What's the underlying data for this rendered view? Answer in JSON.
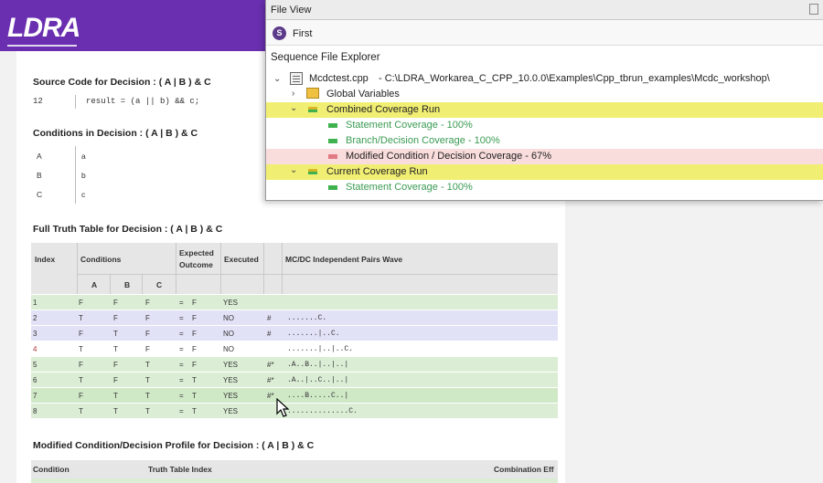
{
  "report": {
    "logo": "LDRA",
    "source_heading": "Source Code for Decision : ( A | B ) & C",
    "source_line_no": "12",
    "source_code": "result = (a || b) && c;",
    "conditions_heading": "Conditions in Decision : ( A | B ) & C",
    "conditions": [
      {
        "key": "A",
        "value": "a"
      },
      {
        "key": "B",
        "value": "b"
      },
      {
        "key": "C",
        "value": "c"
      }
    ],
    "truth_heading": "Full Truth Table for Decision : ( A | B ) & C",
    "truth_table": {
      "headers": {
        "index": "Index",
        "conditions": "Conditions",
        "expected_1": "Expected",
        "expected_2": "Outcome",
        "executed": "Executed",
        "wave": "MC/DC Independent Pairs Wave",
        "a": "A",
        "b": "B",
        "c": "C"
      },
      "rows": [
        {
          "index": "1",
          "a": "F",
          "b": "F",
          "c": "F",
          "eq": "=",
          "out": "F",
          "exec": "YES",
          "mark": "",
          "wave": "",
          "color": "#dbeed5"
        },
        {
          "index": "2",
          "a": "T",
          "b": "F",
          "c": "F",
          "eq": "=",
          "out": "F",
          "exec": "NO",
          "mark": "#",
          "wave": ".......C.",
          "color": "#e2e2f7"
        },
        {
          "index": "3",
          "a": "F",
          "b": "T",
          "c": "F",
          "eq": "=",
          "out": "F",
          "exec": "NO",
          "mark": "#",
          "wave": ".......|..C.",
          "color": "#e2e2f7"
        },
        {
          "index": "4",
          "a": "T",
          "b": "T",
          "c": "F",
          "eq": "=",
          "out": "F",
          "exec": "NO",
          "mark": "",
          "wave": ".......|..|..C.",
          "color": "#ffffff"
        },
        {
          "index": "5",
          "a": "F",
          "b": "F",
          "c": "T",
          "eq": "=",
          "out": "F",
          "exec": "YES",
          "mark": "#*",
          "wave": ".A..B..|..|..|",
          "color": "#dbeed5"
        },
        {
          "index": "6",
          "a": "T",
          "b": "F",
          "c": "T",
          "eq": "=",
          "out": "T",
          "exec": "YES",
          "mark": "#*",
          "wave": ".A..|..C..|..|",
          "color": "#dbeed5"
        },
        {
          "index": "7",
          "a": "F",
          "b": "T",
          "c": "T",
          "eq": "=",
          "out": "T",
          "exec": "YES",
          "mark": "#*",
          "wave": "....B.....C..|",
          "color": "#cfe8c6"
        },
        {
          "index": "8",
          "a": "T",
          "b": "T",
          "c": "T",
          "eq": "=",
          "out": "T",
          "exec": "YES",
          "mark": "",
          "wave": "..............C.",
          "color": "#dbeed5"
        }
      ]
    },
    "profile_heading": "Modified Condition/Decision Profile for Decision : ( A | B ) & C",
    "profile_headers": {
      "condition": "Condition",
      "truth_index": "Truth Table Index",
      "combination": "Combination Eff"
    }
  },
  "file_view": {
    "title": "File View",
    "toolbar_badge": "S",
    "toolbar_label": "First",
    "explorer_label": "Sequence File Explorer",
    "file_name": "Mcdctest.cpp",
    "file_path": " - C:\\LDRA_Workarea_C_CPP_10.0.0\\Examples\\Cpp_tbrun_examples\\Mcdc_workshop\\",
    "global_vars": "Global Variables",
    "combined_run": "Combined Coverage Run",
    "combined_items": [
      "Statement Coverage - 100%",
      "Branch/Decision Coverage - 100%",
      "Modified Condition / Decision Coverage - 67%"
    ],
    "current_run": "Current Coverage Run",
    "current_items": [
      "Statement Coverage - 100%"
    ]
  }
}
